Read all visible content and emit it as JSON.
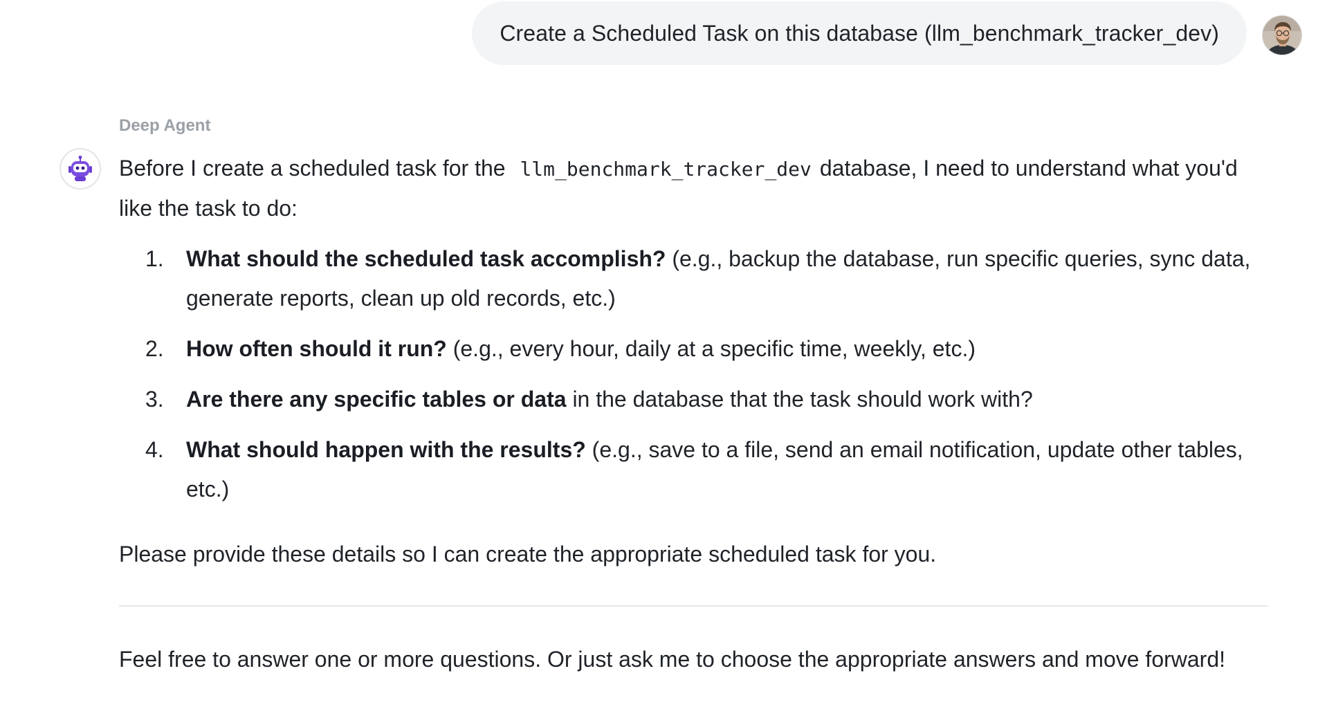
{
  "user_message": {
    "text": "Create a Scheduled Task on this database (llm_benchmark_tracker_dev)"
  },
  "agent": {
    "name": "Deep Agent",
    "intro_before": "Before I create a scheduled task for the",
    "intro_code": "llm_benchmark_tracker_dev",
    "intro_after": "database, I need to understand what you'd like the task to do:",
    "questions": [
      {
        "number": "1.",
        "bold": "What should the scheduled task accomplish?",
        "rest": " (e.g., backup the database, run specific queries, sync data, generate reports, clean up old records, etc.)"
      },
      {
        "number": "2.",
        "bold": "How often should it run?",
        "rest": " (e.g., every hour, daily at a specific time, weekly, etc.)"
      },
      {
        "number": "3.",
        "bold": "Are there any specific tables or data",
        "rest": " in the database that the task should work with?"
      },
      {
        "number": "4.",
        "bold": "What should happen with the results?",
        "rest": " (e.g., save to a file, send an email notification, update other tables, etc.)"
      }
    ],
    "closing": "Please provide these details so I can create the appropriate scheduled task for you.",
    "followup": "Feel free to answer one or more questions. Or just ask me to choose the appropriate answers and move forward!"
  },
  "icons": {
    "user_avatar": "user-avatar-photo",
    "agent_avatar": "robot-icon"
  },
  "colors": {
    "bubble_bg": "#f3f4f6",
    "robot_purple": "#6d3fd4",
    "agent_name": "#9aa0a6",
    "divider": "#e5e7eb"
  }
}
